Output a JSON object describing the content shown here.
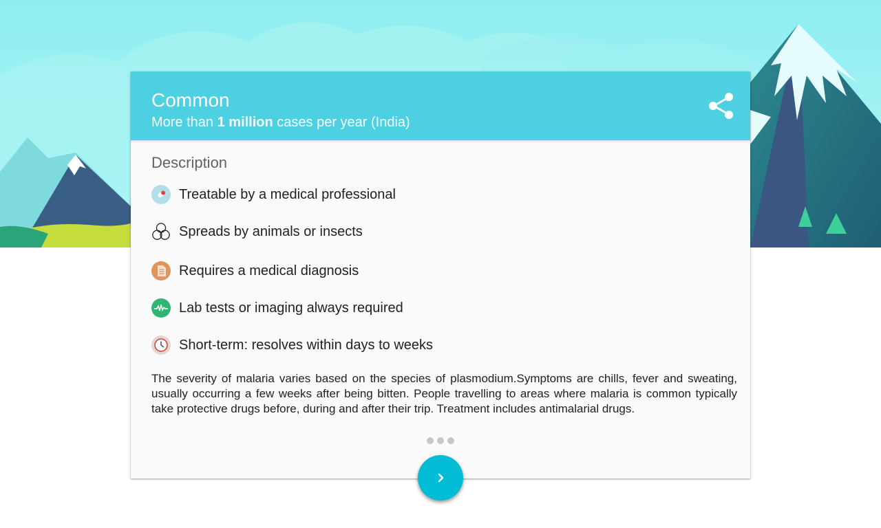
{
  "header": {
    "title": "Common",
    "subtitle_prefix": "More than ",
    "subtitle_bold": "1 million",
    "subtitle_suffix": " cases per year (India)",
    "share_icon": "share-icon"
  },
  "description": {
    "title": "Description",
    "features": [
      {
        "icon": "pill-icon",
        "label": "Treatable by a medical professional"
      },
      {
        "icon": "biohazard-circles-icon",
        "label": "Spreads by animals or insects"
      },
      {
        "icon": "document-icon",
        "label": "Requires a medical diagnosis"
      },
      {
        "icon": "heartbeat-icon",
        "label": "Lab tests or imaging always required"
      },
      {
        "icon": "clock-icon",
        "label": "Short-term: resolves within days to weeks"
      }
    ],
    "body": "The severity of malaria varies based on the species of plasmodium.Symptoms are chills, fever and sweating, usually occurring a few weeks after being bitten. People travelling to areas where malaria is common typically take protective drugs before, during and after their trip. Treatment includes antimalarial drugs."
  },
  "pager": {
    "page_count": 3
  },
  "next_button": {
    "icon": "chevron-right-icon"
  },
  "colors": {
    "header": "#4dd0e1",
    "fab": "#00bcd4",
    "sky": "#8deef0",
    "mountain": "#2f6a85",
    "grass": "#c6dc3c"
  }
}
